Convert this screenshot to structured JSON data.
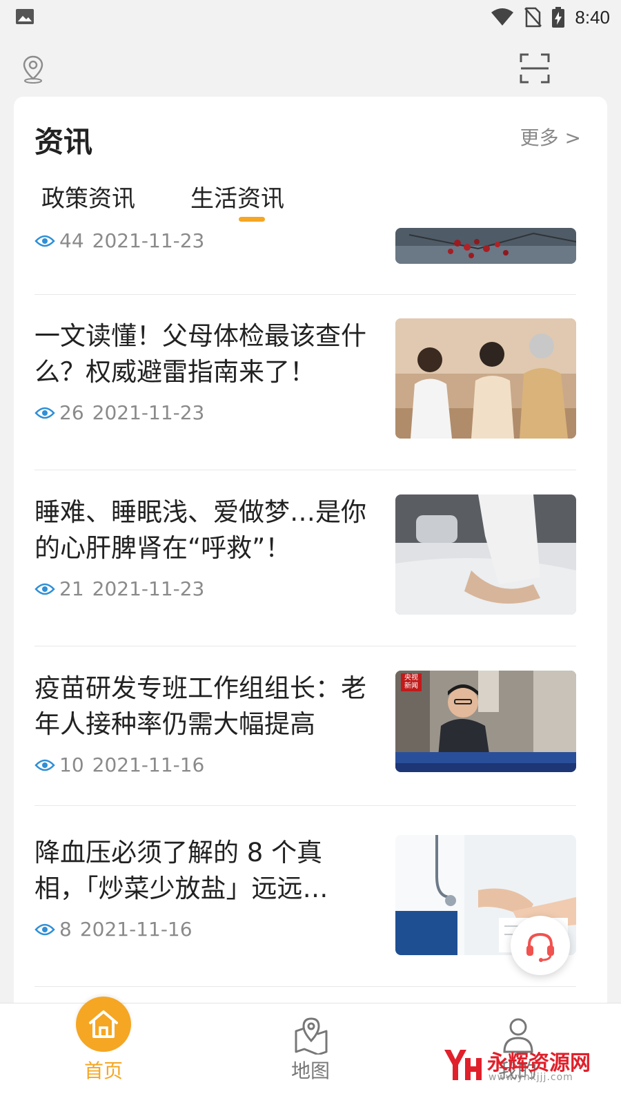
{
  "status_bar": {
    "time": "8:40"
  },
  "news": {
    "title": "资讯",
    "more": "更多 >",
    "tabs": [
      {
        "label": "政策资讯",
        "active": false
      },
      {
        "label": "生活资讯",
        "active": true
      }
    ],
    "items": [
      {
        "title": "",
        "views": "44",
        "date": "2021-11-23"
      },
      {
        "title": "一文读懂！父母体检最该查什么？权威避雷指南来了！",
        "views": "26",
        "date": "2021-11-23"
      },
      {
        "title": "睡难、睡眠浅、爱做梦…是你的心肝脾肾在“呼救”！",
        "views": "21",
        "date": "2021-11-23"
      },
      {
        "title": "疫苗研发专班工作组组长：老年人接种率仍需大幅提高",
        "views": "10",
        "date": "2021-11-16",
        "thumb_badge": "央视新闻"
      },
      {
        "title": "降血压必须了解的 8 个真相，「炒菜少放盐」远远…",
        "views": "8",
        "date": "2021-11-16"
      }
    ]
  },
  "bottom_nav": [
    {
      "label": "首页",
      "icon": "home-icon",
      "active": true
    },
    {
      "label": "地图",
      "icon": "map-pin-icon",
      "active": false
    },
    {
      "label": "我的",
      "icon": "user-icon",
      "active": false
    }
  ],
  "watermark": {
    "text": "永辉资源网",
    "url": "www.yhkjjj.com"
  },
  "colors": {
    "accent": "#f5a623",
    "eye": "#2f8fd6",
    "support": "#f0524f"
  }
}
